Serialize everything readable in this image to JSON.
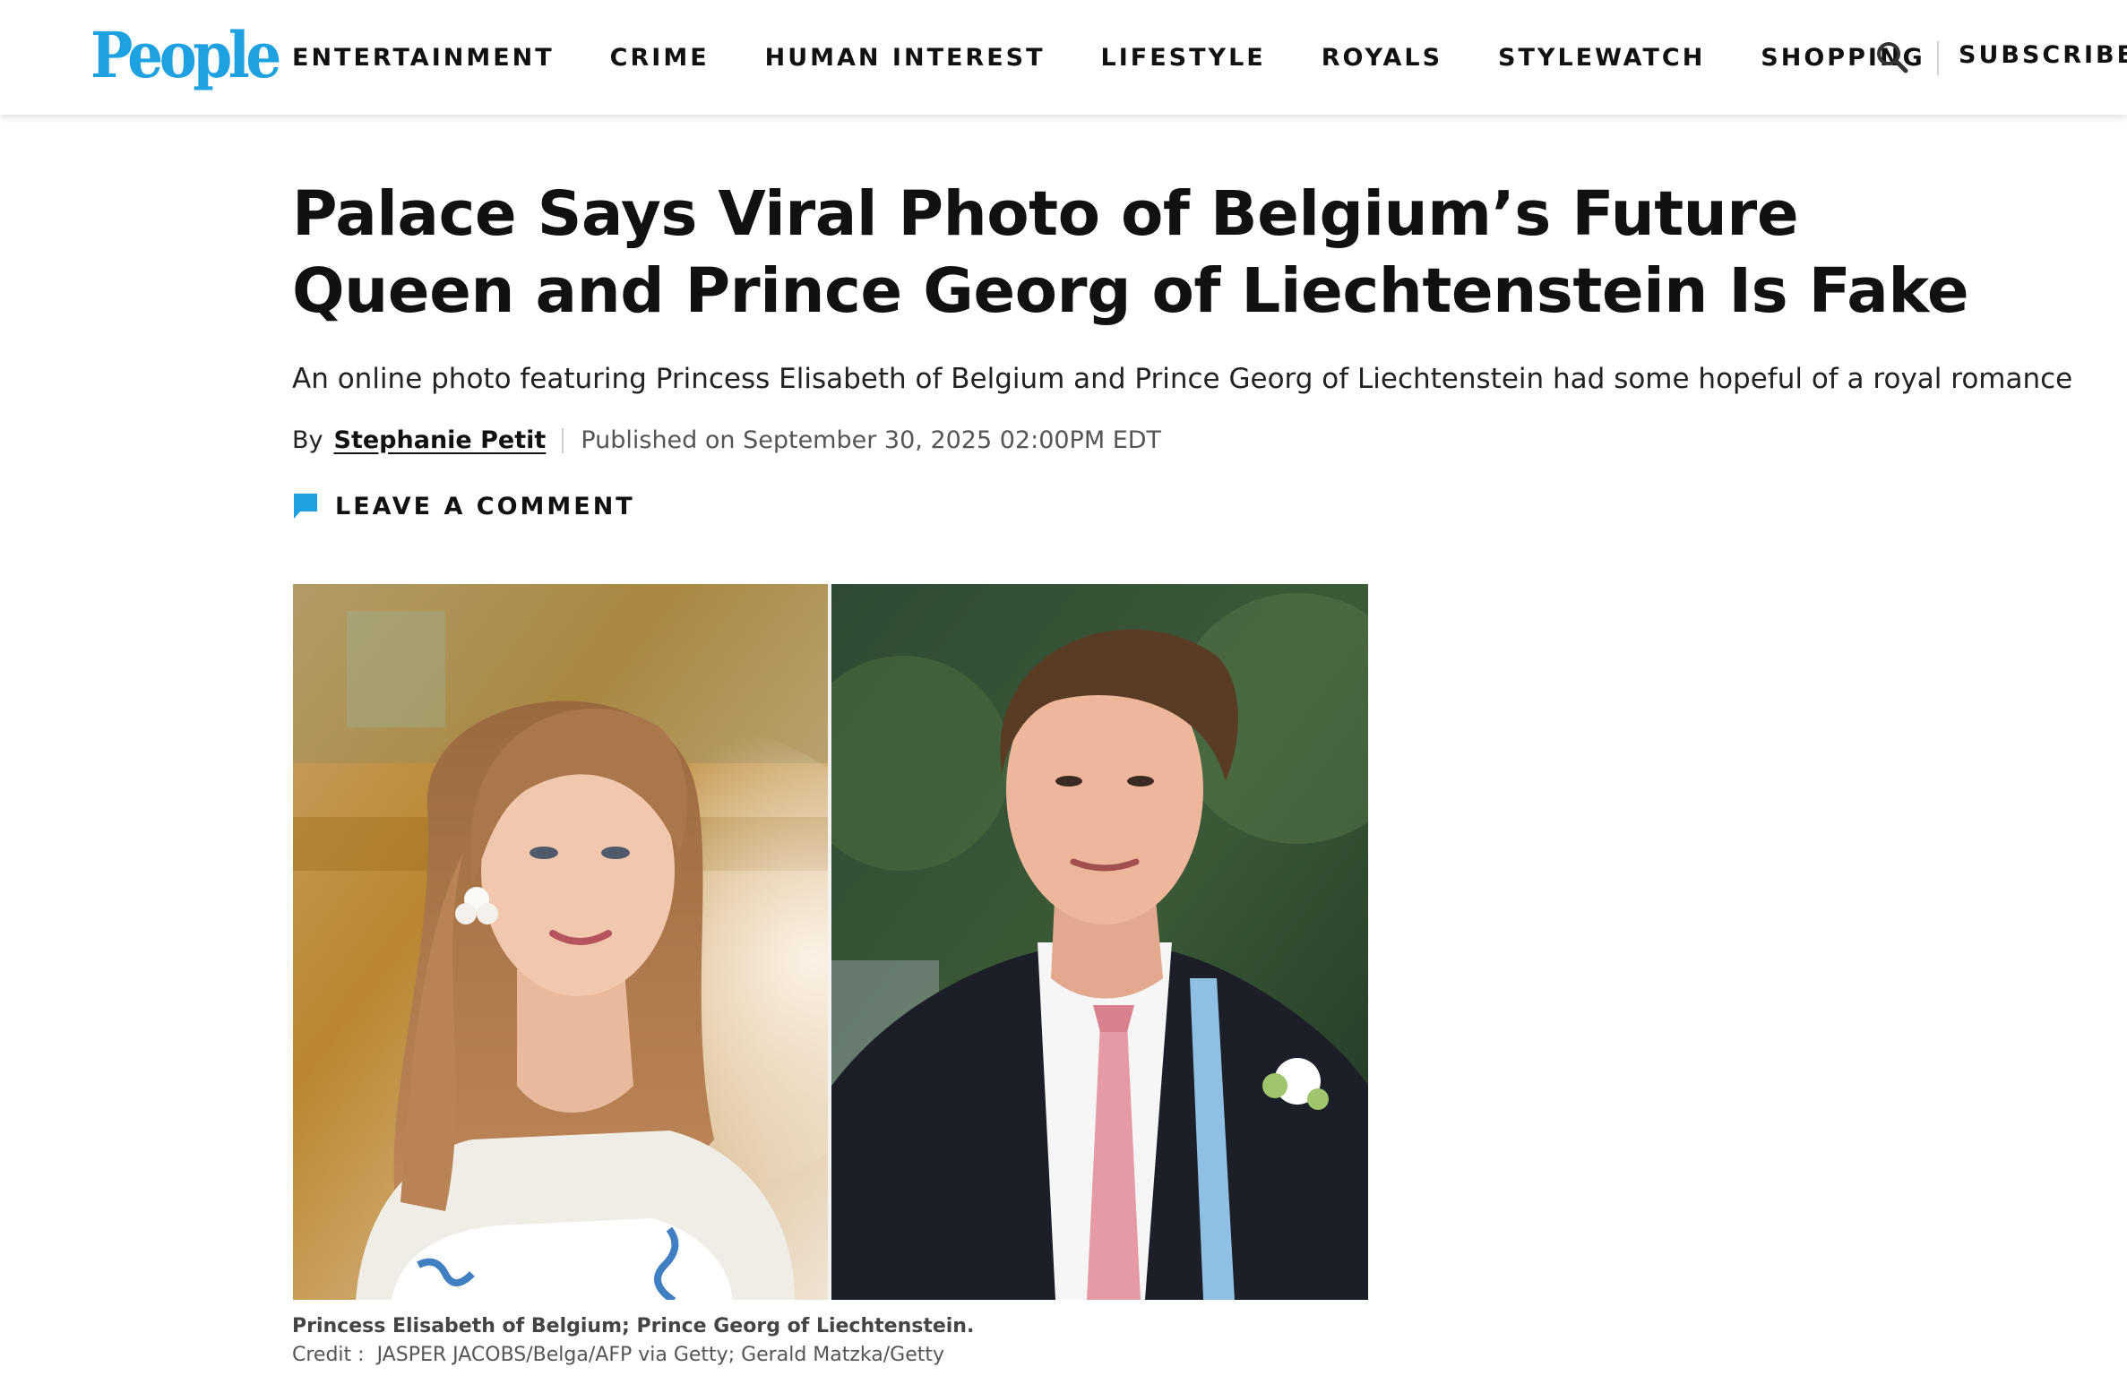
{
  "header": {
    "logo_text": "People",
    "nav": [
      "ENTERTAINMENT",
      "CRIME",
      "HUMAN INTEREST",
      "LIFESTYLE",
      "ROYALS",
      "STYLEWATCH",
      "SHOPPING"
    ],
    "search_icon": "search-icon",
    "subscribe_label": "SUBSCRIBE",
    "brand_color": "#1ea1e0"
  },
  "article": {
    "headline": "Palace Says Viral Photo of Belgium’s Future Queen and Prince Georg of Liechtenstein Is Fake",
    "dek": "An online photo featuring Princess Elisabeth of Belgium and Prince Georg of Liechtenstein had some hopeful of a royal romance",
    "byline_prefix": "By",
    "author": "Stephanie Petit",
    "published": "Published on September 30, 2025 02:00PM EDT",
    "comment_icon": "comment-icon",
    "comment_label": "LEAVE A COMMENT",
    "image": {
      "left_photo": "Princess Elisabeth of Belgium portrait",
      "right_photo": "Prince Georg of Liechtenstein portrait",
      "caption": "Princess Elisabeth of Belgium; Prince Georg of Liechtenstein.",
      "credit_label": "Credit :",
      "credit": "JASPER JACOBS/Belga/AFP via Getty; Gerald Matzka/Getty"
    }
  }
}
